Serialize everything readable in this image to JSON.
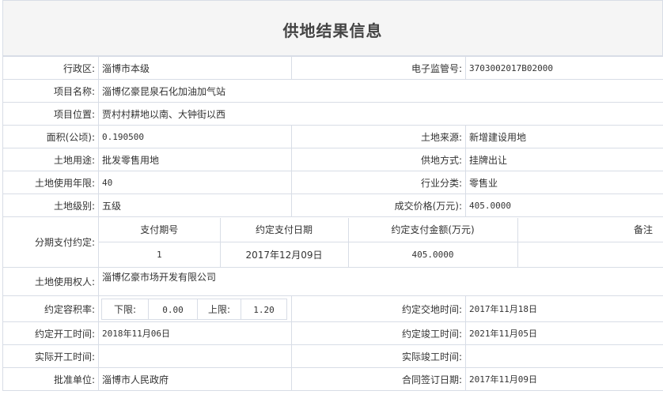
{
  "title": "供地结果信息",
  "rows": {
    "district": {
      "label": "行政区:",
      "value": "淄博市本级"
    },
    "supervision_no": {
      "label": "电子监管号:",
      "value": "3703002017B02000"
    },
    "project_name": {
      "label": "项目名称:",
      "value": "淄博亿豪昆泉石化加油加气站"
    },
    "project_location": {
      "label": "项目位置:",
      "value": "贾村村耕地以南、大钟街以西"
    },
    "area": {
      "label": "面积(公顷):",
      "value": "0.190500"
    },
    "land_source": {
      "label": "土地来源:",
      "value": "新增建设用地"
    },
    "land_use": {
      "label": "土地用途:",
      "value": "批发零售用地"
    },
    "supply_method": {
      "label": "供地方式:",
      "value": "挂牌出让"
    },
    "use_years": {
      "label": "土地使用年限:",
      "value": "40"
    },
    "industry": {
      "label": "行业分类:",
      "value": "零售业"
    },
    "land_grade": {
      "label": "土地级别:",
      "value": "五级"
    },
    "deal_price": {
      "label": "成交价格(万元):",
      "value": "405.0000"
    },
    "installment": {
      "label": "分期支付约定:",
      "headers": [
        "支付期号",
        "约定支付日期",
        "约定支付金额(万元)",
        "备注"
      ],
      "rows": [
        [
          "1",
          "2017年12月09日",
          "405.0000",
          ""
        ]
      ]
    },
    "right_holder": {
      "label": "土地使用权人:",
      "value": "淄博亿豪市场开发有限公司"
    },
    "far": {
      "label": "约定容积率:",
      "lower_label": "下限:",
      "lower": "0.00",
      "upper_label": "上限:",
      "upper": "1.20"
    },
    "handover_time": {
      "label": "约定交地时间:",
      "value": "2017年11月18日"
    },
    "start_time": {
      "label": "约定开工时间:",
      "value": "2018年11月06日"
    },
    "complete_time": {
      "label": "约定竣工时间:",
      "value": "2021年11月05日"
    },
    "actual_start": {
      "label": "实际开工时间:",
      "value": ""
    },
    "actual_complete": {
      "label": "实际竣工时间:",
      "value": ""
    },
    "approval_unit": {
      "label": "批准单位:",
      "value": "淄博市人民政府"
    },
    "contract_date": {
      "label": "合同签订日期:",
      "value": "2017年11月09日"
    }
  }
}
